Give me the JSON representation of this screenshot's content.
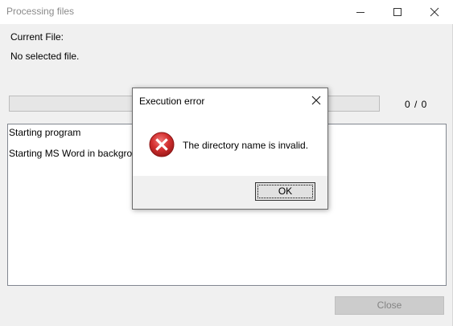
{
  "window": {
    "title": "Processing files",
    "minimize_icon": "minimize-icon",
    "maximize_icon": "maximize-icon",
    "close_icon": "close-icon"
  },
  "file_info": {
    "label": "Current File:",
    "value": "No selected file."
  },
  "progress": {
    "count_text": "0 / 0",
    "fraction": 0
  },
  "log": {
    "lines": [
      "Starting program",
      "Starting MS Word in background"
    ]
  },
  "buttons": {
    "close_label": "Close"
  },
  "dialog": {
    "title": "Execution error",
    "message": "The directory name is invalid.",
    "ok_label": "OK",
    "icon": "error-icon",
    "close_icon": "close-icon"
  },
  "colors": {
    "error_red": "#d32f2f",
    "window_bg": "#f0f0f0"
  }
}
